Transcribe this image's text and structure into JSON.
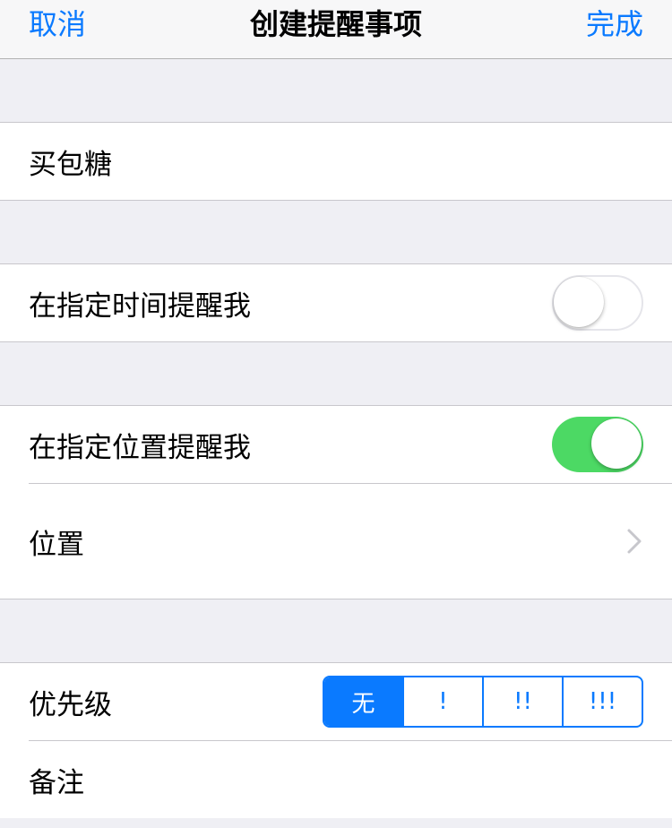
{
  "navbar": {
    "cancel_label": "取消",
    "title": "创建提醒事项",
    "done_label": "完成"
  },
  "reminder_title": "买包糖",
  "time_alert": {
    "label": "在指定时间提醒我",
    "enabled": false
  },
  "location_alert": {
    "label": "在指定位置提醒我",
    "enabled": true
  },
  "location": {
    "label": "位置",
    "icon": "chevron-right-icon"
  },
  "priority": {
    "label": "优先级",
    "options": [
      "无",
      "!",
      "!!",
      "!!!"
    ],
    "selected": "无"
  },
  "notes": {
    "label": "备注"
  },
  "colors": {
    "accent": "#0a7aff",
    "switch_on": "#4cd964",
    "background": "#efeff4",
    "separator": "#c8c7cc"
  }
}
